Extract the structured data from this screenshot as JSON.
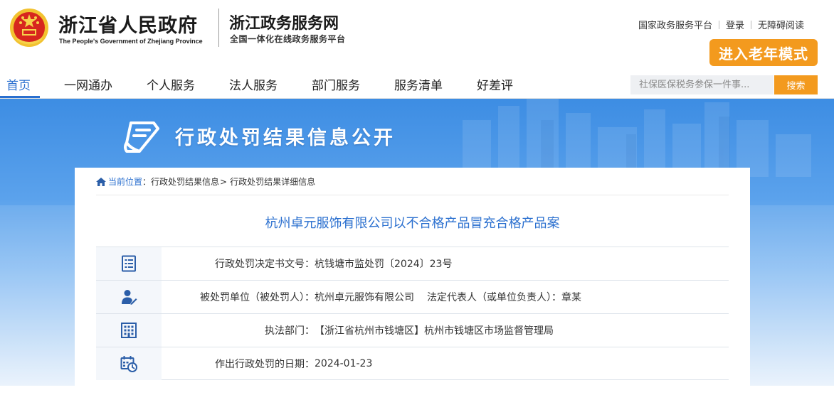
{
  "header": {
    "gov_title": "浙江省人民政府",
    "gov_title_en": "The People's Government of Zhejiang Province",
    "site_title": "浙江政务服务网",
    "site_subtitle": "全国一体化在线政务服务平台",
    "top_links": [
      "国家政务服务平台",
      "登录",
      "无障碍阅读"
    ],
    "elder_mode_label": "进入老年模式"
  },
  "nav": {
    "items": [
      "首页",
      "一网通办",
      "个人服务",
      "法人服务",
      "部门服务",
      "服务清单",
      "好差评"
    ],
    "active_index": 0,
    "search_placeholder": "社保医保税务参保一件事...",
    "search_button": "搜索"
  },
  "banner": {
    "title": "行政处罚结果信息公开"
  },
  "breadcrumb": {
    "prefix": "当前位置",
    "colon": "：",
    "items": [
      "行政处罚结果信息",
      "行政处罚结果详细信息"
    ],
    "separator": ">"
  },
  "case": {
    "title": "杭州卓元服饰有限公司以不合格产品冒充合格产品案",
    "rows": [
      {
        "icon": "document-icon",
        "label": "行政处罚决定书文号：",
        "value": "杭钱塘市监处罚〔2024〕23号"
      },
      {
        "icon": "person-icon",
        "label": "被处罚单位（被处罚人）：",
        "value": "杭州卓元服饰有限公司",
        "label2": "法定代表人（或单位负责人）：",
        "value2": "章某"
      },
      {
        "icon": "building-icon",
        "label": "执法部门：",
        "value": "【浙江省杭州市钱塘区】杭州市钱塘区市场监督管理局"
      },
      {
        "icon": "calendar-icon",
        "label": "作出行政处罚的日期：",
        "value": "2024-01-23"
      }
    ]
  },
  "colors": {
    "accent_blue": "#2a6fcf",
    "orange": "#f39a1e",
    "icon_blue": "#2b5ea8"
  }
}
